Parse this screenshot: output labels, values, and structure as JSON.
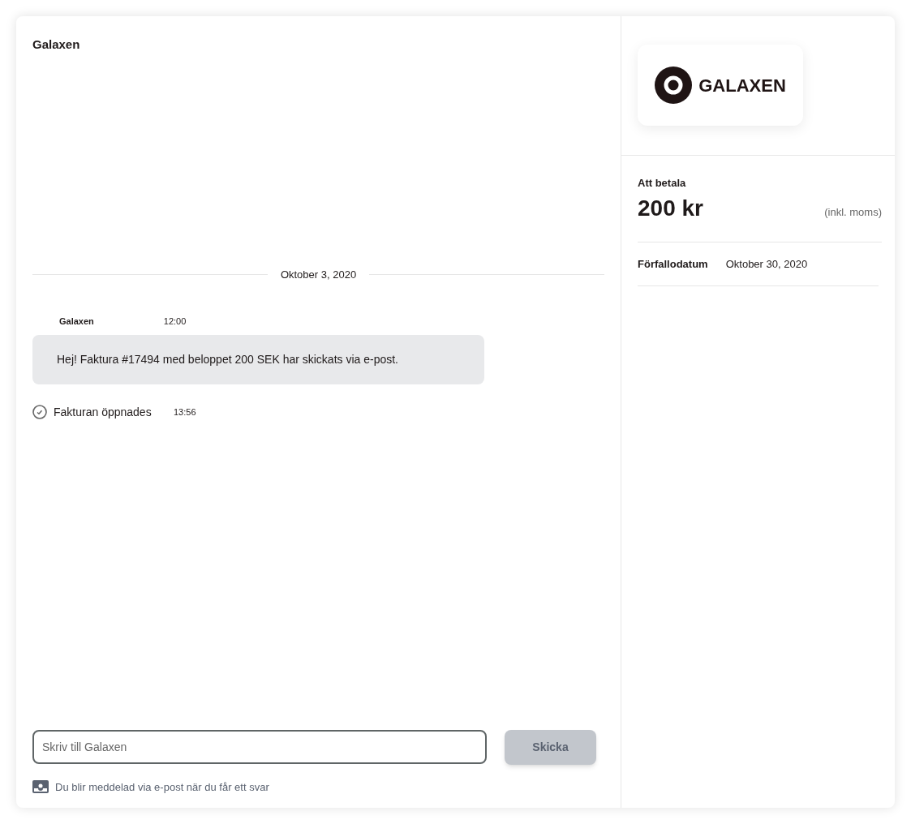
{
  "chat": {
    "title": "Galaxen",
    "date_divider": "Oktober 3, 2020",
    "message": {
      "sender": "Galaxen",
      "time": "12:00",
      "text": "Hej! Faktura #17494 med beloppet 200 SEK har skickats via e-post."
    },
    "event": {
      "text": "Fakturan öppnades",
      "time": "13:56"
    },
    "composer": {
      "placeholder": "Skriv till Galaxen",
      "send_button": {
        "label": "Skicka",
        "disabled": true
      },
      "notice": "Du blir meddelad via e-post när du får ett svar"
    }
  },
  "sidebar": {
    "logo_text": "GALAXEN",
    "amount_label": "Att betala",
    "amount": "200 kr",
    "tax_note": "(inkl. moms)",
    "due_label": "Förfallodatum",
    "due_date": "Oktober 30, 2020"
  }
}
